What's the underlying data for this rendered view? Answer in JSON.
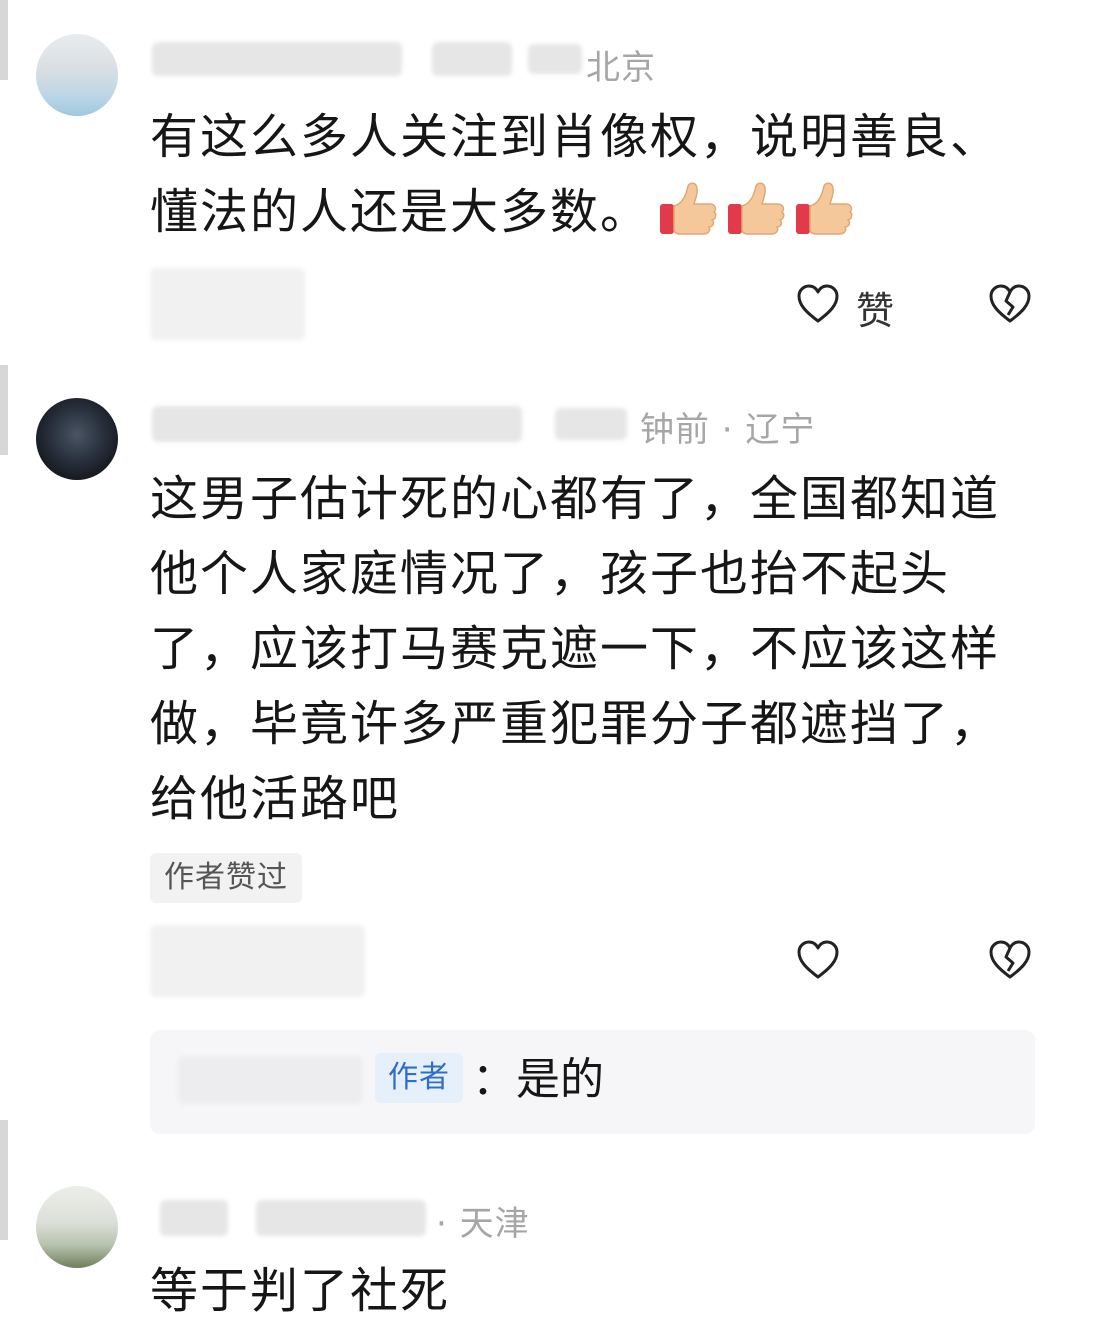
{
  "comments": [
    {
      "meta_tail": "北京",
      "text_lines": [
        "有这么多人关注到肖像权，说明善良、",
        "懂法的人还是大多数。"
      ],
      "emoji": [
        "thumbs-up",
        "thumbs-up",
        "thumbs-up"
      ],
      "like_label": "赞"
    },
    {
      "meta_tail": "钟前 · 辽宁",
      "text_lines": [
        "这男子估计死的心都有了，全国都知道",
        "他个人家庭情况了，孩子也抬不起头",
        "了，应该打马赛克遮一下，不应该这样",
        "做，毕竟许多严重犯罪分子都遮挡了，",
        "给他活路吧"
      ],
      "author_liked": "作者赞过",
      "reply": {
        "author_tag": "作者",
        "text": "：是的"
      }
    },
    {
      "meta_tail": "· 天津",
      "text_lines": [
        "等于判了社死"
      ]
    }
  ],
  "colors": {
    "meta_gray": "#a6a6a6",
    "author_blue": "#2f6ec8",
    "reply_bg": "#f6f6f8"
  }
}
